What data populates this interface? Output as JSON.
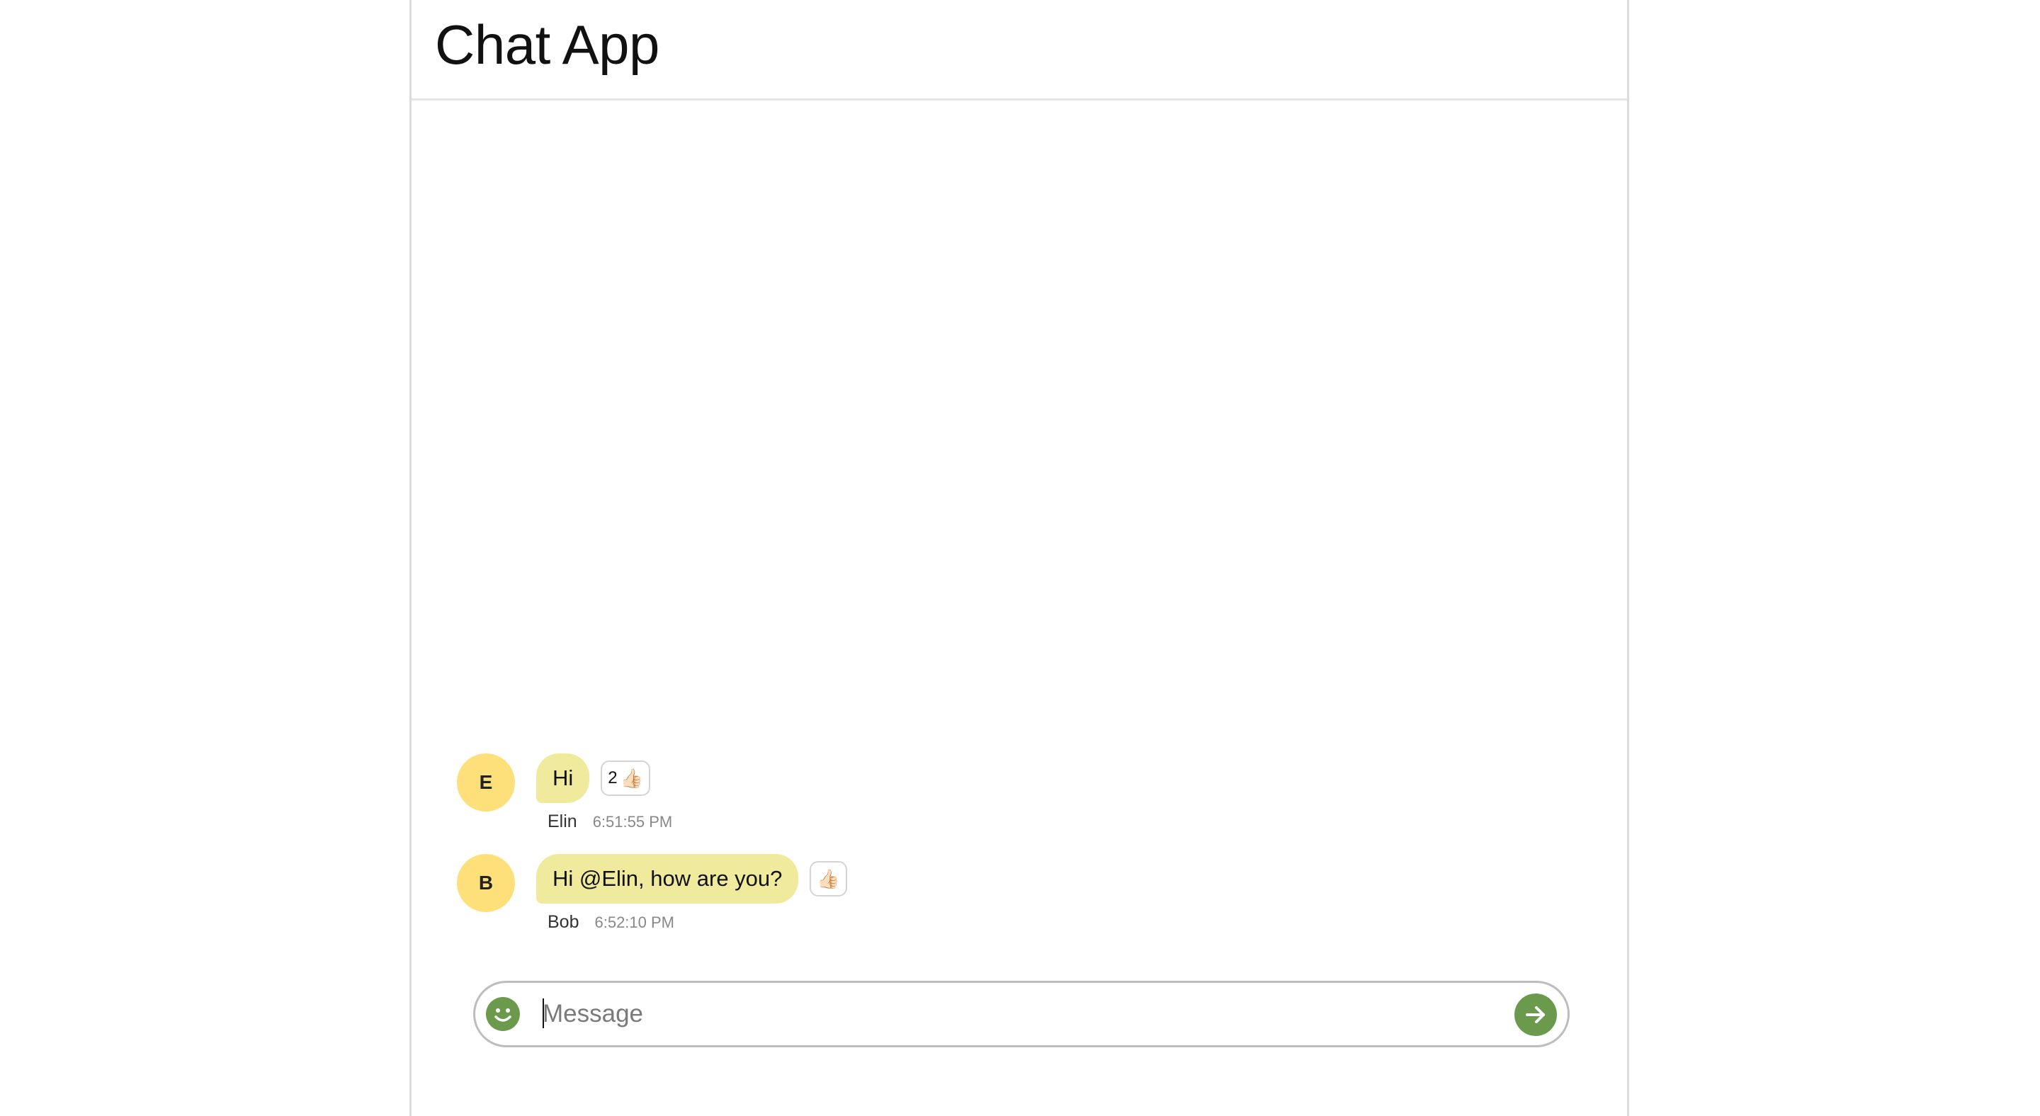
{
  "app": {
    "title": "Chat App"
  },
  "messages": [
    {
      "avatar_initial": "E",
      "text": "Hi",
      "author": "Elin",
      "time": "6:51:55 PM",
      "reaction": {
        "count": "2",
        "emoji": "👍🏻"
      }
    },
    {
      "avatar_initial": "B",
      "text": "Hi @Elin, how are you?",
      "author": "Bob",
      "time": "6:52:10 PM",
      "reaction": {
        "count": "",
        "emoji": "👍🏻"
      }
    }
  ],
  "composer": {
    "placeholder": "Message",
    "value": "",
    "emoji_icon": "smiley-icon",
    "send_icon": "arrow-right-icon"
  },
  "colors": {
    "accent": "#6b9a4c",
    "avatar_bg": "#fde07a",
    "bubble_bg": "#f0ea9d",
    "border": "#dcdcdc"
  }
}
